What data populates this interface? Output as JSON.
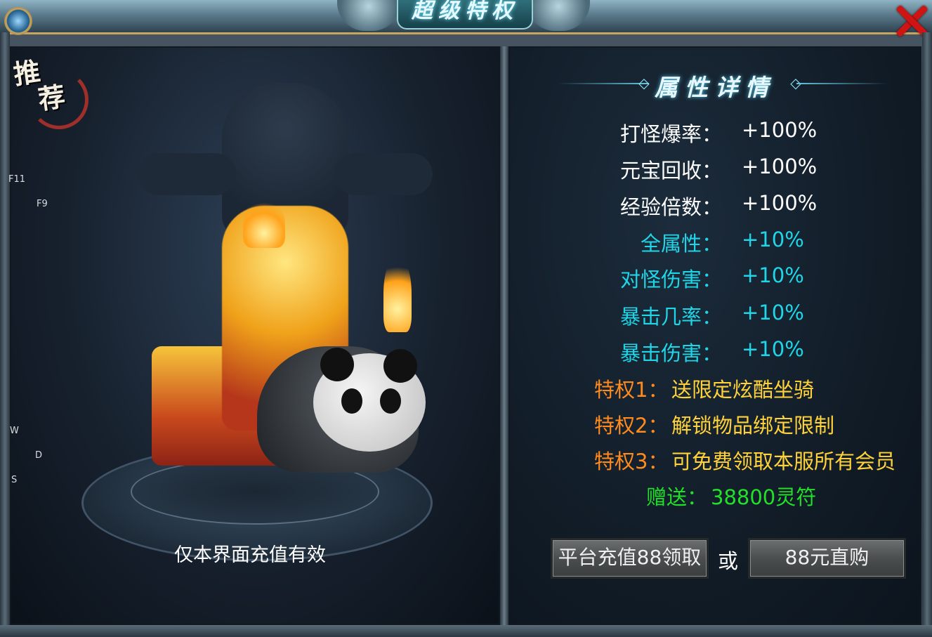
{
  "window": {
    "title": "超级特权",
    "close_icon": "close-x-icon"
  },
  "left": {
    "badge_top": "推",
    "badge_bottom": "荐",
    "hotkeys": [
      "F11",
      "F9",
      "W",
      "D",
      "S"
    ],
    "notice": "仅本界面充值有效"
  },
  "right": {
    "section_title": "属性详情",
    "attributes": [
      {
        "label": "打怪爆率：",
        "value": "+100%",
        "color": "#ffffff"
      },
      {
        "label": "元宝回收：",
        "value": "+100%",
        "color": "#ffffff"
      },
      {
        "label": "经验倍数：",
        "value": "+100%",
        "color": "#ffffff"
      },
      {
        "label": "全属性：",
        "value": "+10%",
        "color": "#1fd6e8"
      },
      {
        "label": "对怪伤害：",
        "value": "+10%",
        "color": "#1fd6e8"
      },
      {
        "label": "暴击几率：",
        "value": "+10%",
        "color": "#1fd6e8"
      },
      {
        "label": "暴击伤害：",
        "value": "+10%",
        "color": "#1fd6e8"
      }
    ],
    "privileges": [
      {
        "label": "特权1：",
        "value": "送限定炫酷坐骑"
      },
      {
        "label": "特权2：",
        "value": "解锁物品绑定限制"
      },
      {
        "label": "特权3：",
        "value": "可免费领取本服所有会员"
      }
    ],
    "privilege_label_color": "#ff8a1e",
    "privilege_value_color": "#ffd23a",
    "gift": {
      "label": "赠送：",
      "value": "38800灵符",
      "color": "#22e02a"
    },
    "buttons": {
      "recharge": "平台充值88领取",
      "or": "或",
      "buy": "88元直购"
    }
  }
}
